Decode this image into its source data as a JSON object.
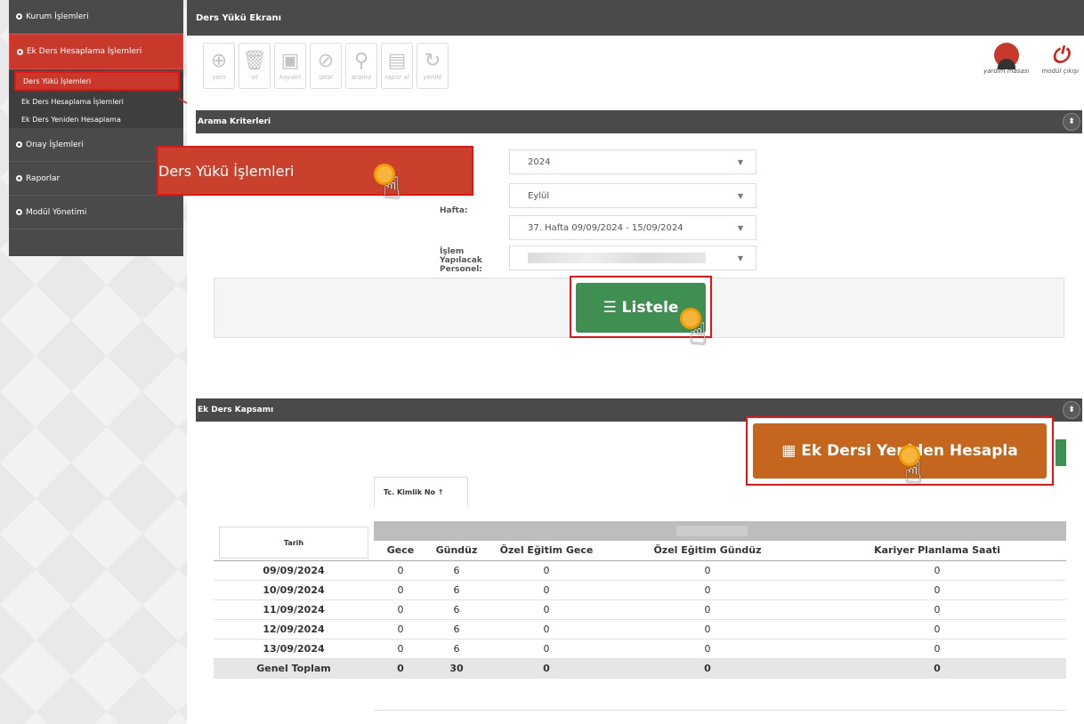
{
  "sidebar": {
    "items": [
      {
        "label": "Kurum İşlemleri"
      },
      {
        "label": "Ek Ders Hesaplama İşlemleri"
      },
      {
        "label": "Onay İşlemleri"
      },
      {
        "label": "Raporlar"
      },
      {
        "label": "Modül Yönetimi"
      }
    ],
    "sub_items": [
      {
        "label": "Ders Yükü İşlemleri"
      },
      {
        "label": "Ek Ders Hesaplama İşlemleri"
      },
      {
        "label": "Ek Ders Yeniden Hesaplama"
      }
    ]
  },
  "header": {
    "title": "Ders Yükü Ekranı"
  },
  "toolbar": {
    "buttons": [
      {
        "label": "yeni",
        "icon": "plus-circle-icon"
      },
      {
        "label": "sil",
        "icon": "trash-icon"
      },
      {
        "label": "kaydet",
        "icon": "save-icon"
      },
      {
        "label": "iptal",
        "icon": "cancel-icon"
      },
      {
        "label": "arama",
        "icon": "search-icon"
      },
      {
        "label": "rapor al",
        "icon": "report-icon"
      },
      {
        "label": "yenile",
        "icon": "refresh-icon"
      }
    ],
    "help_label": "yardım masası",
    "exit_label": "modül çıkışı"
  },
  "search": {
    "section_title": "Arama Kriterleri",
    "year": "2024",
    "month": "Eylül",
    "week_label": "Hafta:",
    "week_value": "37. Hafta 09/09/2024 - 15/09/2024",
    "personnel_label": "İşlem Yapılacak Personel:",
    "list_button": "☰ Listele"
  },
  "callout": {
    "text": "Ders Yükü İşlemleri"
  },
  "scope": {
    "section_title": "Ek Ders Kapsamı",
    "recalc_button": "▦ Ek Dersi Yeniden Hesapla"
  },
  "table": {
    "tc_tab": "Tc. Kimlik No  ↑",
    "date_header": "Tarih",
    "columns": [
      "Gece",
      "Gündüz",
      "Özel Eğitim Gece",
      "Özel Eğitim Gündüz",
      "Kariyer Planlama Saati"
    ],
    "rows": [
      {
        "date": "09/09/2024",
        "values": [
          "0",
          "6",
          "0",
          "0",
          "0"
        ]
      },
      {
        "date": "10/09/2024",
        "values": [
          "0",
          "6",
          "0",
          "0",
          "0"
        ]
      },
      {
        "date": "11/09/2024",
        "values": [
          "0",
          "6",
          "0",
          "0",
          "0"
        ]
      },
      {
        "date": "12/09/2024",
        "values": [
          "0",
          "6",
          "0",
          "0",
          "0"
        ]
      },
      {
        "date": "13/09/2024",
        "values": [
          "0",
          "6",
          "0",
          "0",
          "0"
        ]
      }
    ],
    "total": {
      "label": "Genel Toplam",
      "values": [
        "0",
        "30",
        "0",
        "0",
        "0"
      ]
    }
  },
  "colors": {
    "accent_red": "#c8392b",
    "green": "#3f8f53",
    "orange": "#c4661d",
    "dark_bar": "#4a4a4a"
  }
}
